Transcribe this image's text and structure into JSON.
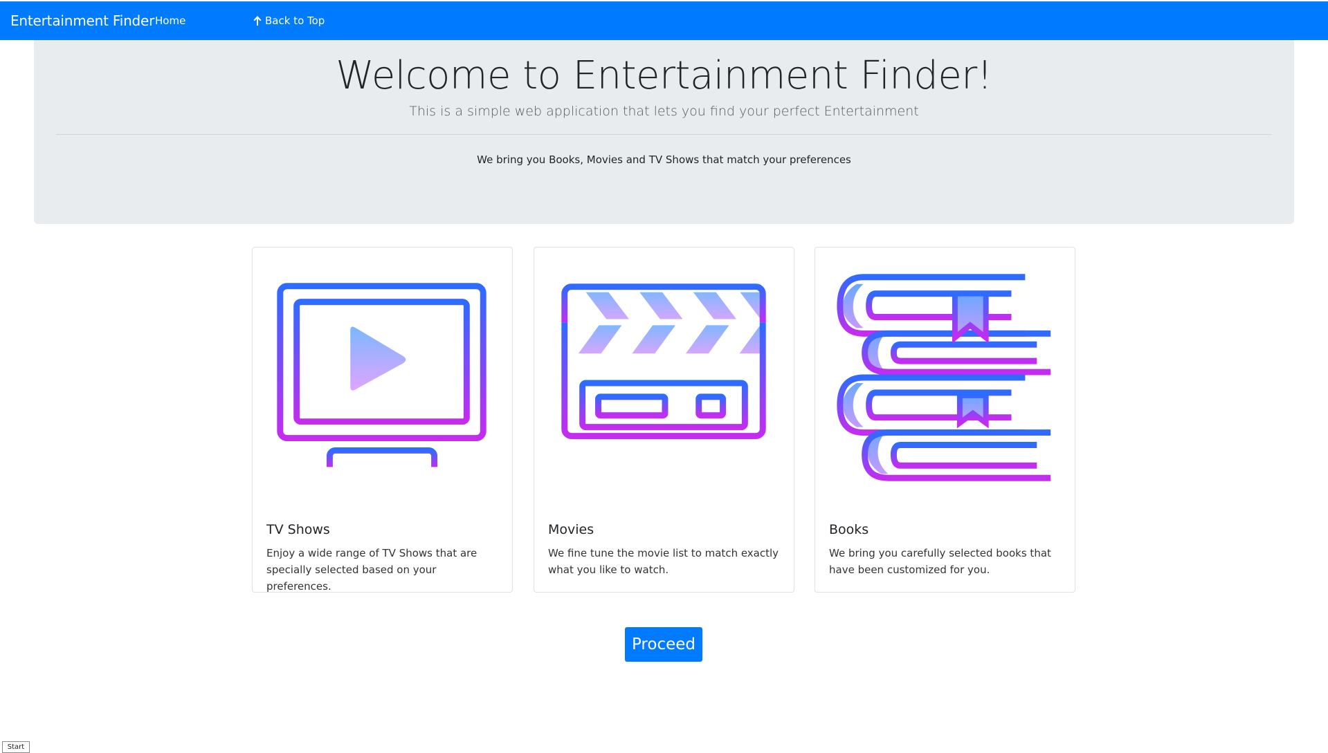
{
  "navbar": {
    "brand": "Entertainment Finder",
    "home_label": "Home",
    "back_to_top_label": "Back to Top",
    "color": "#007bff"
  },
  "jumbotron": {
    "title": "Welcome to Entertainment Finder!",
    "lead": "This is a simple web application that lets you find your perfect Entertainment",
    "text": "We bring you Books, Movies and TV Shows that match your preferences"
  },
  "cards": [
    {
      "icon": "tv-icon",
      "title": "TV Shows",
      "text": "Enjoy a wide range of TV Shows that are specially selected based on your preferences."
    },
    {
      "icon": "clapperboard-icon",
      "title": "Movies",
      "text": "We fine tune the movie list to match exactly what you like to watch."
    },
    {
      "icon": "books-icon",
      "title": "Books",
      "text": "We bring you carefully selected books that have been customized for you."
    }
  ],
  "proceed_label": "Proceed",
  "taskbar": {
    "start_label": "Start"
  },
  "colors": {
    "gradient_top": "#2f6bff",
    "gradient_bottom": "#c42cf0"
  }
}
